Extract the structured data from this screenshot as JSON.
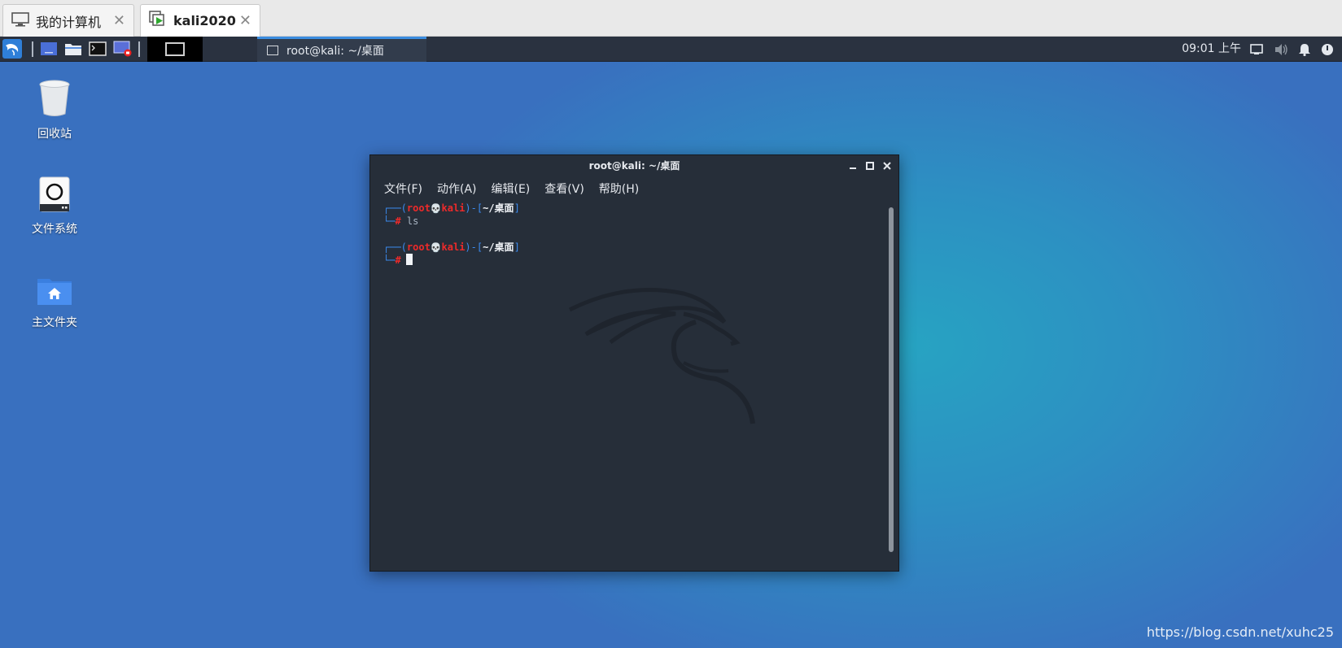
{
  "vm_tabs": [
    {
      "label": "我的计算机",
      "icon": "monitor-icon",
      "close": "✕"
    },
    {
      "label": "kali2020",
      "icon": "vm-running-icon",
      "close": "✕"
    }
  ],
  "panel": {
    "clock": "09:01 上午",
    "task": {
      "label": "root@kali: ~/桌面"
    }
  },
  "desktop_icons": [
    {
      "label": "回收站",
      "icon": "trash-icon"
    },
    {
      "label": "文件系统",
      "icon": "drive-icon"
    },
    {
      "label": "主文件夹",
      "icon": "home-folder-icon"
    }
  ],
  "terminal": {
    "title": "root@kali: ~/桌面",
    "menu": [
      "文件(F)",
      "动作(A)",
      "编辑(E)",
      "查看(V)",
      "帮助(H)"
    ],
    "prompt": {
      "corner_top": "┌──(",
      "user": "root",
      "skull": "💀",
      "host": "kali",
      "sep": ")-[",
      "path": "~/桌面",
      "end": "]",
      "corner_bottom": "└─",
      "hash": "#"
    },
    "command": "ls"
  },
  "watermark": "https://blog.csdn.net/xuhc25",
  "colors": {
    "panel_bg": "#2a3240",
    "terminal_bg": "#262e39",
    "prompt_blue": "#3b8bf0",
    "prompt_red": "#ee2a2a",
    "accent_blue": "#3b8de0"
  }
}
